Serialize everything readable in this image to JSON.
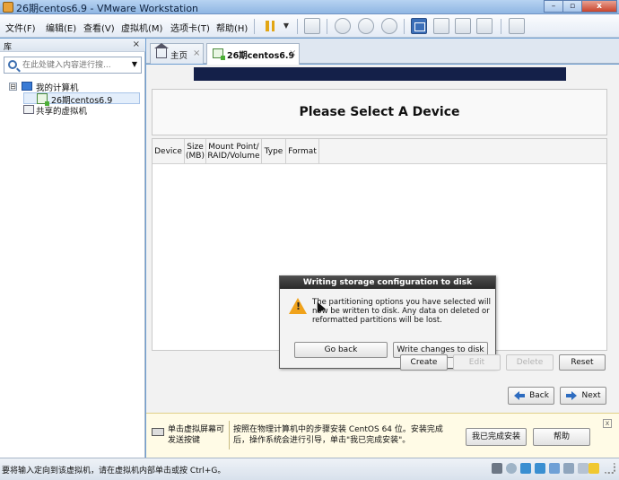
{
  "window": {
    "title": "26期centos6.9 - VMware Workstation",
    "min": "–",
    "max": "▫",
    "close": "x"
  },
  "menu": [
    "文件(F)",
    "编辑(E)",
    "查看(V)",
    "虚拟机(M)",
    "选项卡(T)",
    "帮助(H)"
  ],
  "toolbar": {
    "icons": [
      "pause-icon",
      "dropdown-icon",
      "send-keys-icon",
      "snapshot-icon",
      "revert-snapshot-icon",
      "manage-snapshots-icon",
      "console-view-icon",
      "unity-icon",
      "stretch-icon",
      "fullscreen-icon",
      "library-view-icon"
    ]
  },
  "library": {
    "title": "库",
    "close": "×",
    "search_placeholder": "在此处键入内容进行搜...",
    "tree": [
      {
        "label": "我的计算机",
        "expander": "⊟"
      },
      {
        "label": "26期centos6.9"
      },
      {
        "label": "共享的虚拟机"
      }
    ]
  },
  "tabs": [
    {
      "label": "主页",
      "close": "×"
    },
    {
      "label": "26期centos6.9",
      "close": "×"
    }
  ],
  "installer": {
    "heading": "Please Select A Device",
    "columns": [
      {
        "line1": "Device",
        "line2": ""
      },
      {
        "line1": "Size",
        "line2": "(MB)"
      },
      {
        "line1": "Mount Point/",
        "line2": "RAID/Volume"
      },
      {
        "line1": "Type",
        "line2": ""
      },
      {
        "line1": "Format",
        "line2": ""
      }
    ],
    "buttons": {
      "create": "Create",
      "edit": "Edit",
      "delete": "Delete",
      "reset": "Reset",
      "back": "Back",
      "next": "Next"
    }
  },
  "dialog": {
    "title": "Writing storage configuration to disk",
    "warn_glyph": "!",
    "message": "The partitioning options you have selected will now be written to disk.  Any data on deleted or reformatted partitions will be lost.",
    "go_back": "Go back",
    "write": "Write changes to disk"
  },
  "hint": {
    "click_text": "单击虚拟屏幕可发送按键",
    "instructions": "按照在物理计算机中的步骤安装 CentOS 64 位。安装完成后，操作系统会进行引导，单击\"我已完成安装\"。",
    "done_button": "我已完成安装",
    "help_button": "帮助",
    "close": "x"
  },
  "status": {
    "text": "要将输入定向到该虚拟机，请在虚拟机内部单击或按 Ctrl+G。",
    "tray_icons": [
      "hdd-icon",
      "cdrom-icon",
      "network-icon",
      "usb-icon",
      "sound-icon",
      "printer-icon",
      "display-icon",
      "message-icon",
      "resize-icon"
    ]
  },
  "colors": {
    "banner": "#142049",
    "warning": "#f0a21a",
    "accent": "#2d6cc0"
  }
}
